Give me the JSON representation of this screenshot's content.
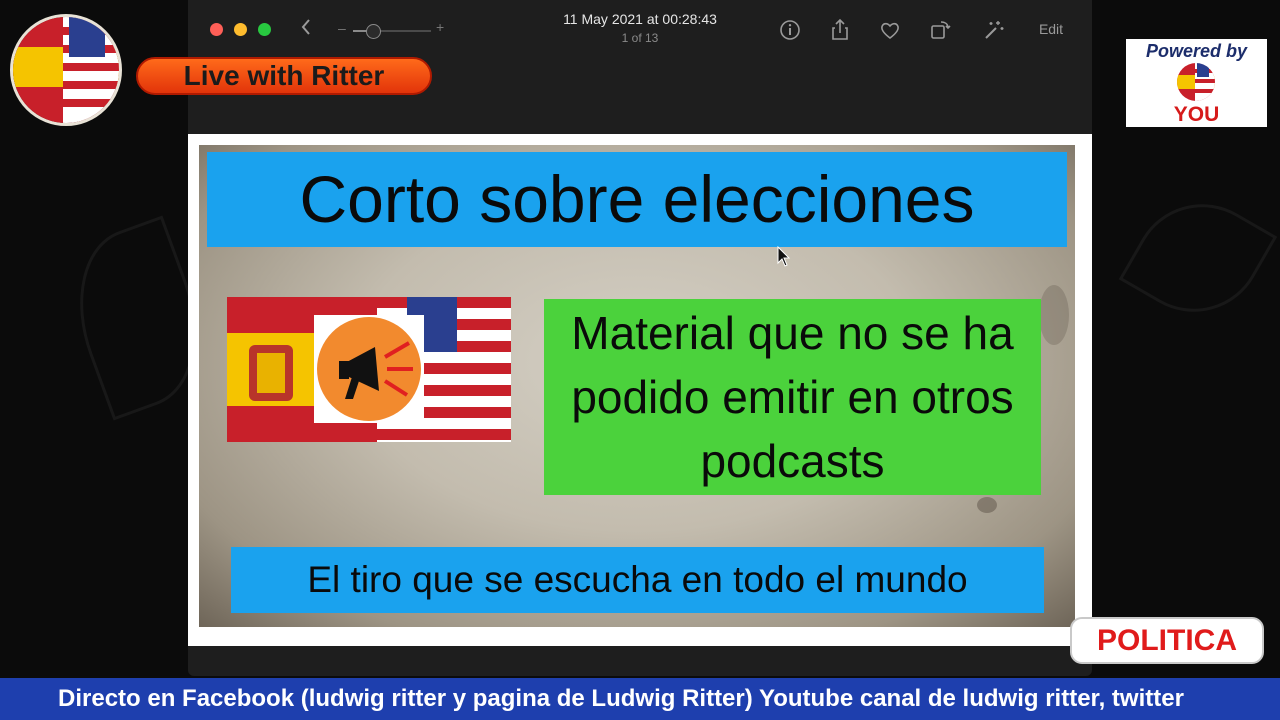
{
  "window": {
    "title_date": "11 May 2021 at 00:28:43",
    "title_count": "1 of 13",
    "edit_label": "Edit",
    "zoom_level": 0.2,
    "zoom_minus": "–",
    "zoom_plus": "+"
  },
  "icons": {
    "back": "chevron-left-icon",
    "info": "info-icon",
    "share": "share-icon",
    "favorite": "heart-icon",
    "rotate": "rotate-icon",
    "enhance": "magic-wand-icon"
  },
  "slide": {
    "title": "Corto sobre elecciones",
    "green_text": "Material que no se ha podido emitir en otros podcasts",
    "bottom_text": "El tiro que se escucha en todo el mundo"
  },
  "overlay": {
    "live_label": "Live with Ritter",
    "powered_by": "Powered by",
    "powered_you": "YOU",
    "category_badge": "POLITICA",
    "ticker": "Directo en Facebook (ludwig ritter y pagina de Ludwig Ritter) Youtube canal de ludwig ritter, twitter"
  },
  "colors": {
    "banner_blue": "#1aa2ee",
    "green_box": "#4bd23c",
    "live_orange": "#ff6a1a",
    "ticker_blue": "#1e3fae",
    "badge_red": "#e01b1b"
  }
}
